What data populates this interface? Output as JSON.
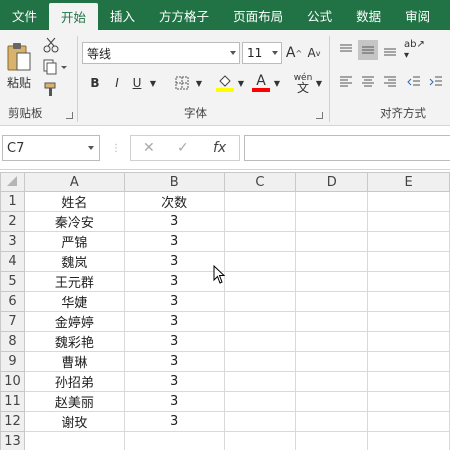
{
  "tabs": [
    "文件",
    "开始",
    "插入",
    "方方格子",
    "页面布局",
    "公式",
    "数据",
    "审阅"
  ],
  "active_tab": 1,
  "ribbon": {
    "clipboard": {
      "paste_label": "粘贴",
      "group_label": "剪贴板"
    },
    "font": {
      "name": "等线",
      "size": "11",
      "group_label": "字体",
      "bold": "B",
      "italic": "I",
      "underline": "U",
      "phonetic": "wén"
    },
    "alignment": {
      "group_label": "对齐方式"
    },
    "colors": {
      "accent": "#217346",
      "highlight": "#ffff00",
      "font_color": "#ff0000"
    }
  },
  "formula_bar": {
    "name_box": "C7",
    "fx": "fx",
    "value": ""
  },
  "columns": [
    "A",
    "B",
    "C",
    "D",
    "E"
  ],
  "rows": [
    [
      "姓名",
      "次数"
    ],
    [
      "秦冷安",
      "3"
    ],
    [
      "严锦",
      "3"
    ],
    [
      "魏岚",
      "3"
    ],
    [
      "王元群",
      "3"
    ],
    [
      "华婕",
      "3"
    ],
    [
      "金婷婷",
      "3"
    ],
    [
      "魏彩艳",
      "3"
    ],
    [
      "曹琳",
      "3"
    ],
    [
      "孙招弟",
      "3"
    ],
    [
      "赵美丽",
      "3"
    ],
    [
      "谢玫",
      "3"
    ],
    [
      "",
      ""
    ],
    [
      "",
      ""
    ]
  ]
}
